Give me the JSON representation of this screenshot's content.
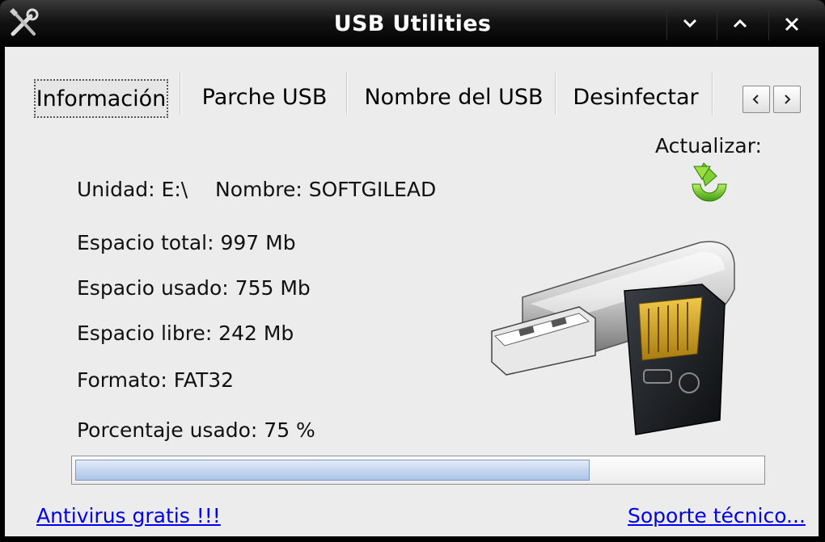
{
  "window": {
    "title": "USB Utilities"
  },
  "tabs": [
    {
      "label": "Información",
      "active": true
    },
    {
      "label": "Parche USB",
      "active": false
    },
    {
      "label": "Nombre del USB",
      "active": false
    },
    {
      "label": "Desinfectar",
      "active": false
    }
  ],
  "refresh": {
    "label": "Actualizar:"
  },
  "info": {
    "drive": "Unidad: E:\\",
    "name": "Nombre: SOFTGILEAD",
    "total": "Espacio total: 997 Mb",
    "used": "Espacio usado: 755 Mb",
    "free": "Espacio libre: 242 Mb",
    "format": "Formato: FAT32",
    "percent_used": "Porcentaje usado: 75 %"
  },
  "progress": {
    "value": 0.75
  },
  "links": {
    "antivirus": "Antivirus gratis !!!",
    "support": "Soporte técnico..."
  },
  "colors": {
    "titlebar": "#000000",
    "client_bg": "#ececec",
    "link": "#0000ee",
    "progress_fill": "#c6d6ef"
  },
  "icons": [
    "tools-icon",
    "minimize-icon",
    "maximize-icon",
    "close-icon",
    "tab-scroll-left-icon",
    "tab-scroll-right-icon",
    "refresh-icon",
    "usb-device-icon"
  ]
}
